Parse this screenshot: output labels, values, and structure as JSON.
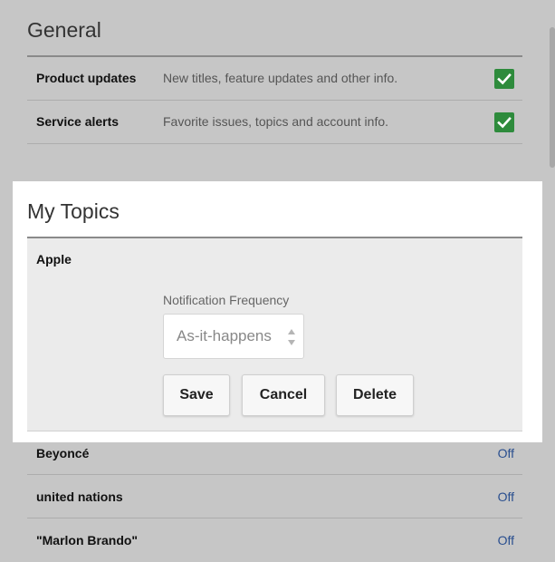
{
  "general": {
    "title": "General",
    "rows": [
      {
        "label": "Product updates",
        "description": "New titles, feature updates and other info.",
        "checked": true
      },
      {
        "label": "Service alerts",
        "description": "Favorite issues, topics and account info.",
        "checked": true
      }
    ]
  },
  "my_topics": {
    "title": "My Topics",
    "expanded_topic": {
      "name": "Apple",
      "frequency_label": "Notification Frequency",
      "frequency_value": "As-it-happens",
      "save_label": "Save",
      "cancel_label": "Cancel",
      "delete_label": "Delete"
    },
    "topics": [
      {
        "name": "Beyoncé",
        "status": "Off"
      },
      {
        "name": "united nations",
        "status": "Off"
      },
      {
        "name": "\"Marlon Brando\"",
        "status": "Off"
      }
    ]
  },
  "colors": {
    "checkbox": "#2e8b3c",
    "link": "#2a4f8f",
    "overlay_background": "#c6c6c6"
  }
}
